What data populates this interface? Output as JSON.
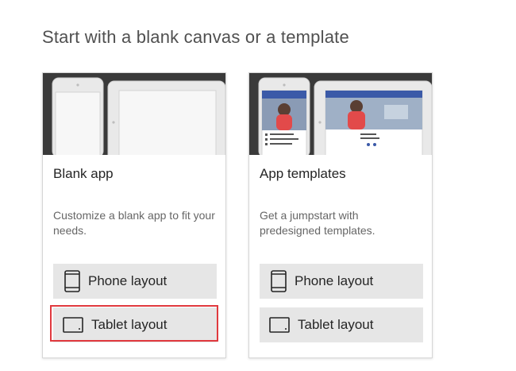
{
  "page": {
    "heading": "Start with a blank canvas or a template"
  },
  "cards": [
    {
      "title": "Blank app",
      "description": "Customize a blank app to fit your needs.",
      "phone_button": "Phone layout",
      "tablet_button": "Tablet layout"
    },
    {
      "title": "App templates",
      "description": "Get a jumpstart with predesigned templates.",
      "phone_button": "Phone layout",
      "tablet_button": "Tablet layout"
    }
  ],
  "colors": {
    "preview_background": "#3a3a3a",
    "button_background": "#e6e6e6",
    "highlight_border": "#e0393e",
    "template_header_blue": "#3b5aa8"
  },
  "icons": {
    "phone_button": "phone-icon",
    "tablet_button": "tablet-icon"
  },
  "highlighted_element": "blank-app-tablet-layout-button"
}
